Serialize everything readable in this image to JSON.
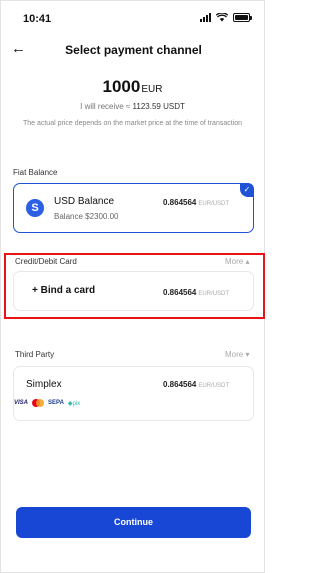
{
  "status": {
    "time": "10:41"
  },
  "header": {
    "title": "Select payment channel"
  },
  "amount": {
    "value": "1000",
    "currency": "EUR"
  },
  "receive": {
    "prefix": "I will receive ≈",
    "value": "1123.59 USDT"
  },
  "note": "The actual price depends on the market price at the time of transaction",
  "sections": {
    "fiat": {
      "label": "Fiat Balance",
      "item": {
        "name": "USD Balance",
        "balance": "Balance $2300.00",
        "rate": "0.864564",
        "rate_unit": "EUR/USDT",
        "selected": true
      }
    },
    "card": {
      "label": "Credit/Debit Card",
      "more": "More",
      "item": {
        "name": "+ Bind a card",
        "rate": "0.864564",
        "rate_unit": "EUR/USDT"
      }
    },
    "third_party": {
      "label": "Third Party",
      "more": "More",
      "item": {
        "name": "Simplex",
        "rate": "0.864564",
        "rate_unit": "EUR/USDT",
        "logos": [
          "VISA",
          "mastercard",
          "SEPA",
          "pix"
        ]
      }
    }
  },
  "continue_label": "Continue",
  "colors": {
    "accent": "#1847d6",
    "highlight": "#e8141a"
  }
}
